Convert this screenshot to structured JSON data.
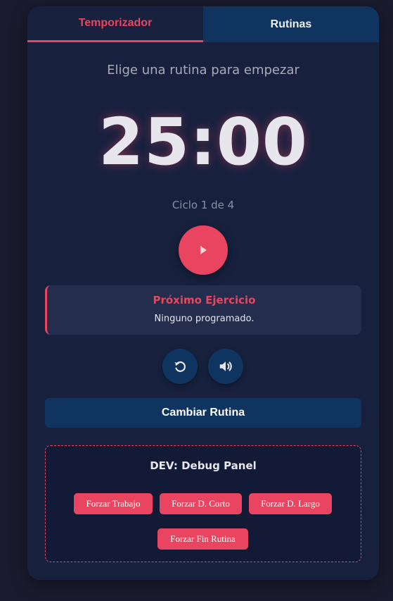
{
  "tabs": {
    "timer": "Temporizador",
    "routines": "Rutinas"
  },
  "main": {
    "subtitle": "Elige una rutina para empezar",
    "time": "25:00",
    "cycle": "Ciclo 1 de 4"
  },
  "next_exercise": {
    "title": "Próximo Ejercicio",
    "text": "Ninguno programado."
  },
  "actions": {
    "change_routine": "Cambiar Rutina"
  },
  "debug": {
    "title": "DEV: Debug Panel",
    "buttons": [
      "Forzar Trabajo",
      "Forzar D. Corto",
      "Forzar D. Largo",
      "Forzar Fin Rutina"
    ]
  },
  "icons": {
    "play": "play-icon",
    "reset": "reset-icon",
    "sound": "volume-icon"
  },
  "colors": {
    "accent": "#e94560",
    "panel": "#17213e",
    "secondary": "#0f3460",
    "background": "#1b1b2f"
  }
}
